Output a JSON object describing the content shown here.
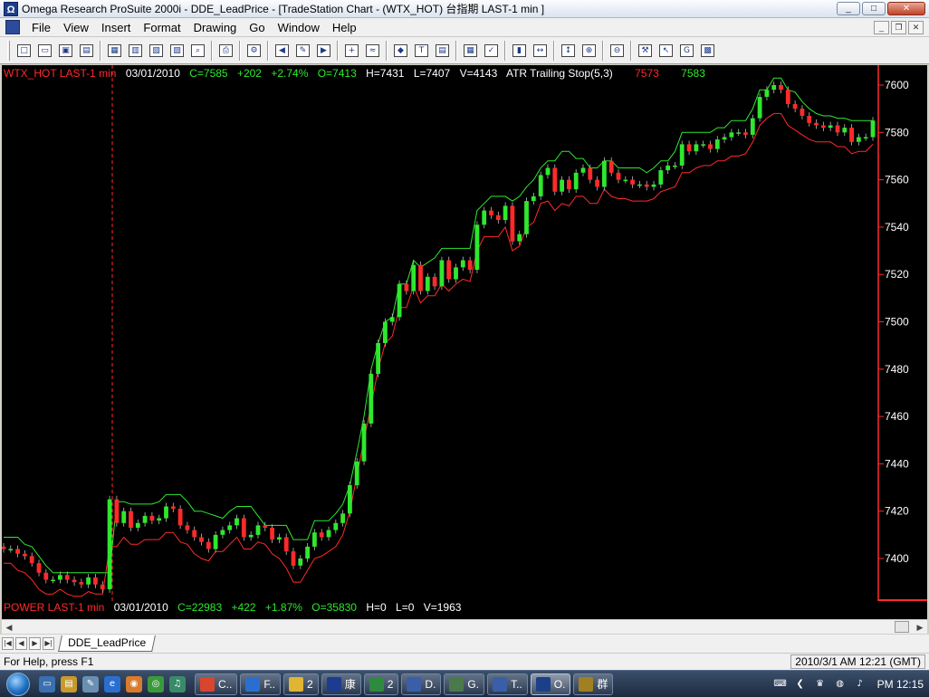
{
  "window": {
    "title": "Omega Research ProSuite 2000i - DDE_LeadPrice - [TradeStation Chart - (WTX_HOT) 台指期 LAST-1 min ]",
    "app_icon": "omega-logo-icon",
    "controls": {
      "minimize": "_",
      "maximize": "□",
      "close": "✕"
    }
  },
  "menubar": {
    "items": [
      "File",
      "View",
      "Insert",
      "Format",
      "Drawing",
      "Go",
      "Window",
      "Help"
    ],
    "mdi_controls": {
      "minimize": "_",
      "restore": "❐",
      "close": "✕"
    }
  },
  "toolbar": {
    "icons": [
      "new-doc-icon",
      "open-folder-icon",
      "open-workspace-icon",
      "save-workspace-icon",
      "new-chart-window-icon",
      "new-radarscreen-icon",
      "new-optionstation-icon",
      "new-news-window-icon",
      "symbol-lookup-icon",
      "print-icon",
      "format-window-icon",
      "previous-page-icon",
      "format-symbol-icon",
      "next-page-icon",
      "insert-analysis-icon",
      "insert-indicator-icon",
      "insert-strategy-icon",
      "insert-text-icon",
      "insert-sheet-icon",
      "insert-grid-icon",
      "show-me-icon",
      "paint-bar-icon",
      "zoom-bars-in-icon",
      "zoom-bars-out-icon",
      "zoom-in-icon",
      "zoom-out-icon",
      "hammer-tools-icon",
      "pointer-icon",
      "gf-icon",
      "lock-icon"
    ]
  },
  "chart": {
    "main_info": {
      "symbol": "WTX_HOT LAST-1 min",
      "date": "03/01/2010",
      "close": "C=7585",
      "change": "+202",
      "pct": "+2.74%",
      "open": "O=7413",
      "high": "H=7431",
      "low": "L=7407",
      "volume": "V=4143",
      "indicator": "ATR Trailing Stop(5,3)",
      "ind_val1": "7573",
      "ind_val2": "7583"
    },
    "sub_info": {
      "symbol": "POWER LAST-1 min",
      "date": "03/01/2010",
      "close": "C=22983",
      "change": "+422",
      "pct": "+1.87%",
      "open": "O=35830",
      "high": "H=0",
      "low": "L=0",
      "volume": "V=1963"
    },
    "colors": {
      "background": "#000000",
      "up_candle": "#2ee82e",
      "down_candle": "#ff2a2a",
      "stop_line_upper": "#2ee82e",
      "stop_line_lower": "#ff2a2a",
      "axis": "#ff2a2a"
    }
  },
  "chart_data": {
    "type": "candlestick",
    "title": "WTX_HOT LAST-1 min",
    "xlabel": "",
    "ylabel": "",
    "ylim": [
      7387,
      7607
    ],
    "y_ticks": [
      7400,
      7420,
      7440,
      7460,
      7480,
      7500,
      7520,
      7540,
      7560,
      7580,
      7600
    ],
    "grid": false,
    "series": [
      {
        "name": "Price",
        "values": [
          7404,
          7404,
          7402,
          7401,
          7398,
          7394,
          7391,
          7391,
          7393,
          7391,
          7390,
          7389,
          7392,
          7389,
          7387,
          7425,
          7415,
          7420,
          7413,
          7415,
          7418,
          7416,
          7417,
          7422,
          7421,
          7414,
          7412,
          7409,
          7407,
          7404,
          7410,
          7412,
          7414,
          7417,
          7409,
          7410,
          7414,
          7413,
          7408,
          7409,
          7403,
          7397,
          7400,
          7405,
          7411,
          7409,
          7412,
          7415,
          7419,
          7431,
          7441,
          7457,
          7478,
          7491,
          7500,
          7502,
          7516,
          7513,
          7524,
          7513,
          7519,
          7515,
          7526,
          7518,
          7523,
          7526,
          7522,
          7541,
          7547,
          7545,
          7543,
          7549,
          7534,
          7537,
          7551,
          7553,
          7562,
          7565,
          7555,
          7560,
          7556,
          7563,
          7565,
          7560,
          7557,
          7568,
          7563,
          7560,
          7560,
          7558,
          7558,
          7557,
          7558,
          7564,
          7566,
          7566,
          7575,
          7572,
          7575,
          7575,
          7573,
          7577,
          7578,
          7580,
          7580,
          7579,
          7586,
          7595,
          7598,
          7600,
          7598,
          7592,
          7590,
          7587,
          7584,
          7583,
          7582,
          7583,
          7580,
          7582,
          7576,
          7578,
          7578,
          7585
        ]
      },
      {
        "name": "Upper stop",
        "values": [
          7409,
          7409,
          7409,
          7406,
          7405,
          7401,
          7397,
          7394,
          7394,
          7394,
          7394,
          7394,
          7394,
          7394,
          7394,
          7394,
          7424,
          7424,
          7423,
          7423,
          7423,
          7423,
          7424,
          7427,
          7427,
          7427,
          7424,
          7420,
          7420,
          7419,
          7418,
          7417,
          7420,
          7422,
          7422,
          7422,
          7418,
          7414,
          7414,
          7414,
          7414,
          7408,
          7408,
          7408,
          7416,
          7416,
          7416,
          7419,
          7423,
          7431,
          7445,
          7460,
          7480,
          7491,
          7500,
          7502,
          7516,
          7516,
          7526,
          7523,
          7525,
          7527,
          7531,
          7531,
          7531,
          7531,
          7531,
          7547,
          7550,
          7553,
          7553,
          7553,
          7551,
          7553,
          7557,
          7560,
          7565,
          7568,
          7568,
          7572,
          7572,
          7569,
          7569,
          7565,
          7565,
          7568,
          7568,
          7565,
          7565,
          7565,
          7565,
          7563,
          7565,
          7568,
          7568,
          7572,
          7580,
          7580,
          7580,
          7580,
          7580,
          7582,
          7582,
          7585,
          7585,
          7585,
          7590,
          7598,
          7598,
          7603,
          7603,
          7598,
          7597,
          7593,
          7590,
          7588,
          7587,
          7587,
          7586,
          7586,
          7585,
          7585,
          7585,
          7585
        ]
      },
      {
        "name": "Lower stop",
        "values": [
          7398,
          7398,
          7395,
          7394,
          7391,
          7387,
          7385,
          7385,
          7387,
          7385,
          7384,
          7384,
          7386,
          7385,
          7385,
          7405,
          7405,
          7409,
          7406,
          7406,
          7408,
          7408,
          7408,
          7411,
          7411,
          7407,
          7406,
          7402,
          7400,
          7399,
          7403,
          7403,
          7406,
          7409,
          7404,
          7404,
          7407,
          7406,
          7402,
          7400,
          7396,
          7390,
          7390,
          7395,
          7400,
          7401,
          7403,
          7405,
          7410,
          7420,
          7435,
          7450,
          7465,
          7480,
          7491,
          7494,
          7506,
          7506,
          7515,
          7508,
          7511,
          7511,
          7516,
          7513,
          7516,
          7518,
          7517,
          7530,
          7536,
          7536,
          7536,
          7540,
          7530,
          7532,
          7540,
          7542,
          7550,
          7551,
          7547,
          7550,
          7549,
          7553,
          7553,
          7550,
          7550,
          7556,
          7553,
          7552,
          7552,
          7551,
          7551,
          7551,
          7552,
          7555,
          7556,
          7557,
          7563,
          7563,
          7565,
          7566,
          7566,
          7568,
          7568,
          7570,
          7570,
          7571,
          7576,
          7583,
          7586,
          7588,
          7588,
          7583,
          7581,
          7579,
          7577,
          7576,
          7576,
          7576,
          7574,
          7574,
          7571,
          7572,
          7572,
          7575
        ]
      }
    ]
  },
  "sheet_tabs": {
    "nav": [
      "|◀",
      "◀",
      "▶",
      "▶|"
    ],
    "active": "DDE_LeadPrice"
  },
  "statusbar": {
    "help": "For Help, press F1",
    "datetime": "2010/3/1 AM 12:21 (GMT)"
  },
  "taskbar": {
    "quick_launch": [
      "show-desktop-icon",
      "explorer-icon",
      "notepad-icon",
      "ie-icon",
      "firefox-icon",
      "chrome-icon",
      "media-icon"
    ],
    "buttons": [
      {
        "icon": "chrome-icon",
        "label": "C..",
        "color": "#d9452f"
      },
      {
        "icon": "ie-icon",
        "label": "F..",
        "color": "#2a6fcf"
      },
      {
        "icon": "folder-icon",
        "label": "2",
        "color": "#e0b534"
      },
      {
        "icon": "app-kang-icon",
        "label": "康",
        "color": "#1b3c8f"
      },
      {
        "icon": "excel-icon",
        "label": "2",
        "color": "#2e8a3e"
      },
      {
        "icon": "app-d-icon",
        "label": "D.",
        "color": "#3a5fa8"
      },
      {
        "icon": "app-g-icon",
        "label": "G.",
        "color": "#4a7a4a"
      },
      {
        "icon": "app-t-icon",
        "label": "T..",
        "color": "#3a5fa8"
      },
      {
        "icon": "omega-icon",
        "label": "O.",
        "color": "#1c3f8a"
      },
      {
        "icon": "crown-icon",
        "label": "群",
        "color": "#a08020"
      }
    ],
    "clock": "PM 12:15"
  }
}
